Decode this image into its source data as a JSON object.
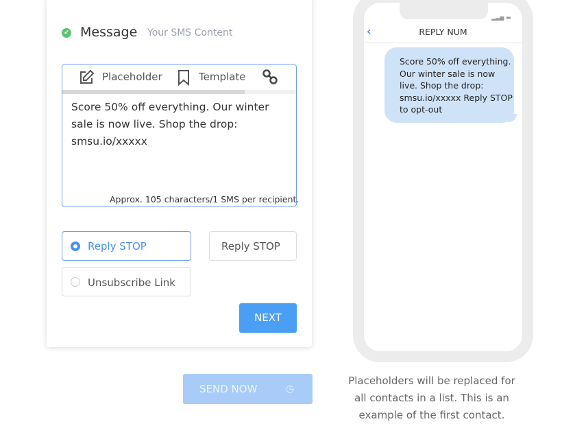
{
  "header": {
    "title": "Message",
    "subtitle": "Your SMS Content"
  },
  "editor": {
    "toolbar": {
      "placeholder_label": "Placeholder",
      "template_label": "Template"
    },
    "message": "Score 50% off everything. Our winter sale is now live. Shop the drop: smsu.io/xxxxx",
    "counter": "Approx. 105 characters/1 SMS per recipient.",
    "scroll_fraction": 0.78
  },
  "optout": {
    "options": [
      {
        "label": "Reply STOP",
        "selected": true
      },
      {
        "label": "Unsubscribe Link",
        "selected": false
      }
    ],
    "text_value": "Reply STOP"
  },
  "buttons": {
    "next": "NEXT",
    "send_now": "SEND NOW"
  },
  "preview": {
    "contact": "REPLY NUM",
    "bubble": "Score 50% off everything. Our winter sale is now live. Shop the drop: smsu.io/xxxxx Reply STOP to opt-out",
    "caption": "Placeholders will be replaced for all contacts in a list. This is an example of the first contact."
  },
  "colors": {
    "accent": "#4a9ff5",
    "success": "#5cc36f",
    "bubble": "#cfe3f8"
  }
}
